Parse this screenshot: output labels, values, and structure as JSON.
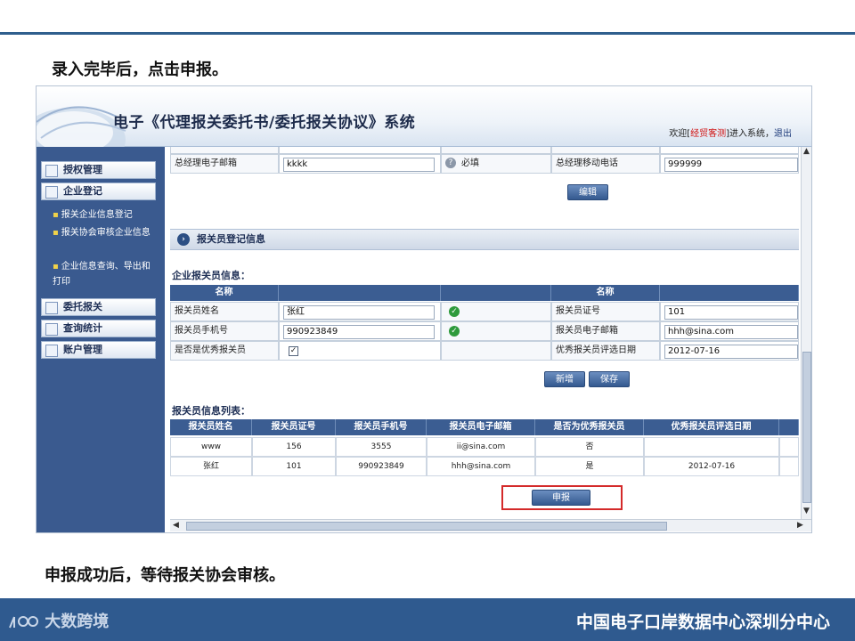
{
  "slide": {
    "caption_top": "录入完毕后，点击申报。",
    "caption_bottom": "申报成功后，等待报关协会审核。",
    "footer_brand": "大数跨境",
    "footer_right": "中国电子口岸数据中心深圳分中心"
  },
  "app": {
    "title": "电子《代理报关委托书/委托报关协议》系统",
    "welcome_prefix": "欢迎[",
    "username": "经贸客测",
    "welcome_suffix": "]进入系统，",
    "logout": "退出"
  },
  "sidebar": {
    "auth": "授权管理",
    "enterprise": "企业登记",
    "sub_items": [
      "报关企业信息登记",
      "报关协会审核企业信息",
      "企业信息查询、导出和打印"
    ],
    "entrust": "委托报关",
    "stats": "查询统计",
    "account": "账户管理"
  },
  "manager_row": {
    "email_label": "总经理电子邮箱",
    "email_value": "kkkk",
    "required": "必填",
    "mobile_label": "总经理移动电话",
    "mobile_value": "999999"
  },
  "edit_button": "编辑",
  "section_title": "报关员登记信息",
  "form_title": "企业报关员信息：",
  "form_head": {
    "name_col1": "名称",
    "name_col2": "名称"
  },
  "form": {
    "name_label": "报关员姓名",
    "name_value": "张红",
    "cert_label": "报关员证号",
    "cert_value": "101",
    "phone_label": "报关员手机号",
    "phone_value": "990923849",
    "email_label": "报关员电子邮箱",
    "email_value": "hhh@sina.com",
    "excellent_label": "是否是优秀报关员",
    "excellent_checked": "✓",
    "date_label": "优秀报关员评选日期",
    "date_value": "2012-07-16"
  },
  "add_button": "新增",
  "save_button": "保存",
  "list_title": "报关员信息列表：",
  "list_headers": [
    "报关员姓名",
    "报关员证号",
    "报关员手机号",
    "报关员电子邮箱",
    "是否为优秀报关员",
    "优秀报关员评选日期"
  ],
  "list_rows": [
    [
      "www",
      "156",
      "3555",
      "ii@sina.com",
      "否",
      ""
    ],
    [
      "张红",
      "101",
      "990923849",
      "hhh@sina.com",
      "是",
      "2012-07-16"
    ]
  ],
  "submit_button": "申报",
  "colors": {
    "accent": "#2f5a8f",
    "highlight": "#d42a2a"
  }
}
